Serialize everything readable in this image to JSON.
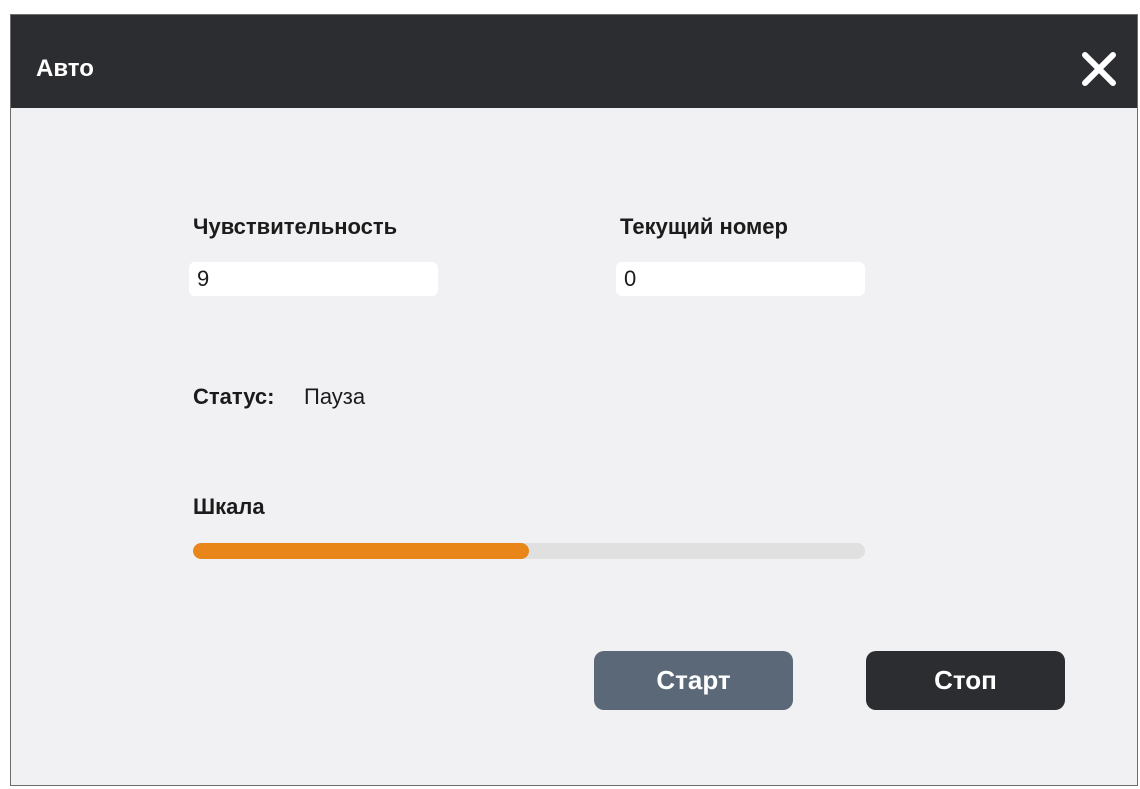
{
  "window": {
    "title": "Авто"
  },
  "fields": {
    "sensitivity": {
      "label": "Чувствительность",
      "value": "9"
    },
    "current_number": {
      "label": "Текущий номер",
      "value": "0"
    }
  },
  "status": {
    "label": "Статус:",
    "value": "Пауза"
  },
  "scale": {
    "label": "Шкала",
    "progress_percent": 50
  },
  "buttons": {
    "start_label": "Старт",
    "stop_label": "Стоп"
  },
  "colors": {
    "titlebar": "#2c2d30",
    "accent": "#e8861a",
    "start_button": "#5a6878",
    "stop_button": "#2c2d30"
  },
  "icons": {
    "close": "close-icon"
  }
}
